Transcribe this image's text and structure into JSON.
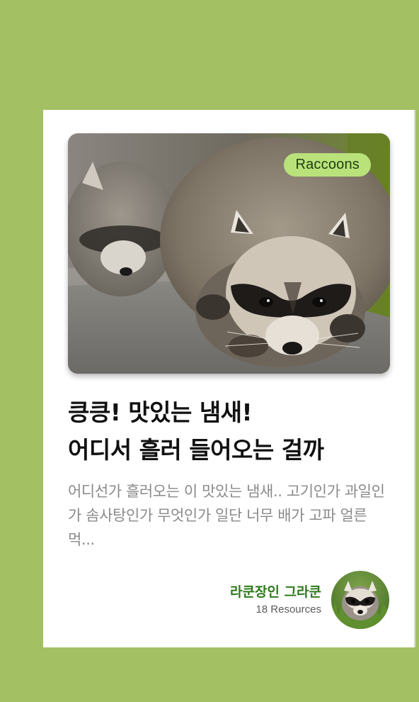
{
  "card": {
    "tag": "Raccoons",
    "image_icon": "raccoon-photo",
    "title_lines": [
      "킁킁! 맛있는 냄새!",
      "어디서 흘러 들어오는 걸까"
    ],
    "excerpt": "어디선가 흘러오는 이 맛있는 냄새.. 고기인가 과일인가 솜사탕인가 무엇인가 일단 너무 배가 고파 얼른 먹...",
    "author": {
      "name": "라쿤장인 그라쿤",
      "resources": "18 Resources",
      "avatar_icon": "raccoon-avatar"
    }
  },
  "colors": {
    "background": "#a3c063",
    "card": "#ffffff",
    "tag_background": "#b9e27b",
    "author_name": "#2f7a1d",
    "excerpt": "#8a8a8a"
  }
}
